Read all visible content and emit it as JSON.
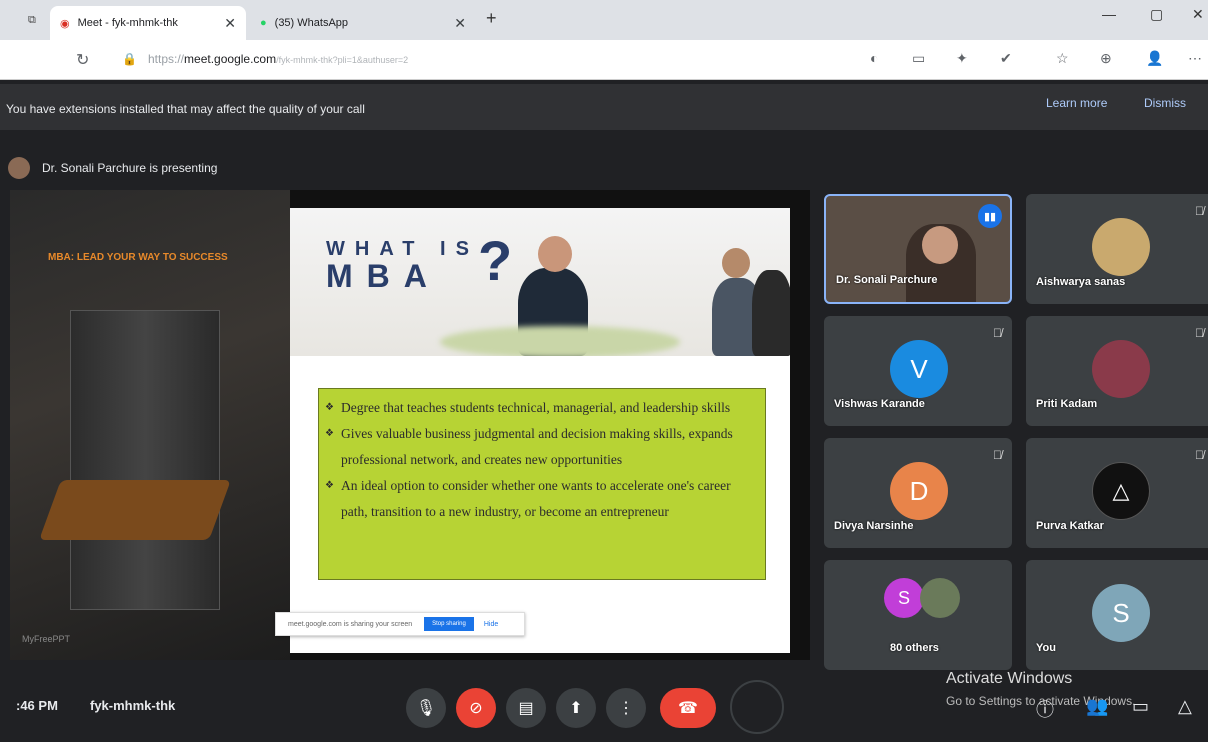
{
  "browser": {
    "tabs": [
      {
        "label": "Meet - fyk-mhmk-thk"
      },
      {
        "label": "(35) WhatsApp"
      }
    ],
    "url_host": "meet.google.com",
    "url_prefix": "https://",
    "url_rest": "/fyk-mhmk-thk?pli=1&authuser=2"
  },
  "meet": {
    "extension_notice": "You have extensions installed that may affect the quality of your call",
    "learn_more": "Learn more",
    "dismiss": "Dismiss",
    "presenting": "Dr. Sonali Parchure is presenting"
  },
  "slide": {
    "tagline": "MBA: LEAD YOUR WAY TO SUCCESS",
    "title_top": "WHAT IS",
    "title_bottom": "MBA",
    "question_mark": "?",
    "bullets": [
      "Degree that teaches students technical, managerial, and leadership skills",
      "Gives valuable business judgmental and decision making skills, expands professional network, and creates new opportunities",
      "An ideal option to consider whether one wants to accelerate one's career path, transition to a new industry, or become an entrepreneur"
    ],
    "watermark": "MyFreePPT",
    "share_text": "meet.google.com is sharing your screen",
    "stop_sharing": "Stop sharing",
    "hide": "Hide"
  },
  "participants": [
    {
      "name": "Dr. Sonali Parchure",
      "initial": "",
      "color": "#6b5a4a"
    },
    {
      "name": "Aishwarya sanas",
      "initial": "",
      "color": "#c9a96e"
    },
    {
      "name": "Vishwas Karande",
      "initial": "V",
      "color": "#1a8be0"
    },
    {
      "name": "Priti Kadam",
      "initial": "",
      "color": "#8a3a4a"
    },
    {
      "name": "Divya Narsinhe",
      "initial": "D",
      "color": "#e8844a"
    },
    {
      "name": "Purva Katkar",
      "initial": "",
      "color": "#111111"
    },
    {
      "name": "80 others",
      "initial": "S",
      "color": "#c13ed8"
    },
    {
      "name": "You",
      "initial": "S",
      "color": "#7fa6b8"
    }
  ],
  "footer": {
    "time": ":46 PM",
    "meeting_code": "fyk-mhmk-thk",
    "activate_title": "Activate Windows",
    "activate_sub": "Go to Settings to activate Windows."
  },
  "colors": {
    "end_call": "#ea4335",
    "cam_off": "#ea4335",
    "accent": "#8ab4f8"
  }
}
